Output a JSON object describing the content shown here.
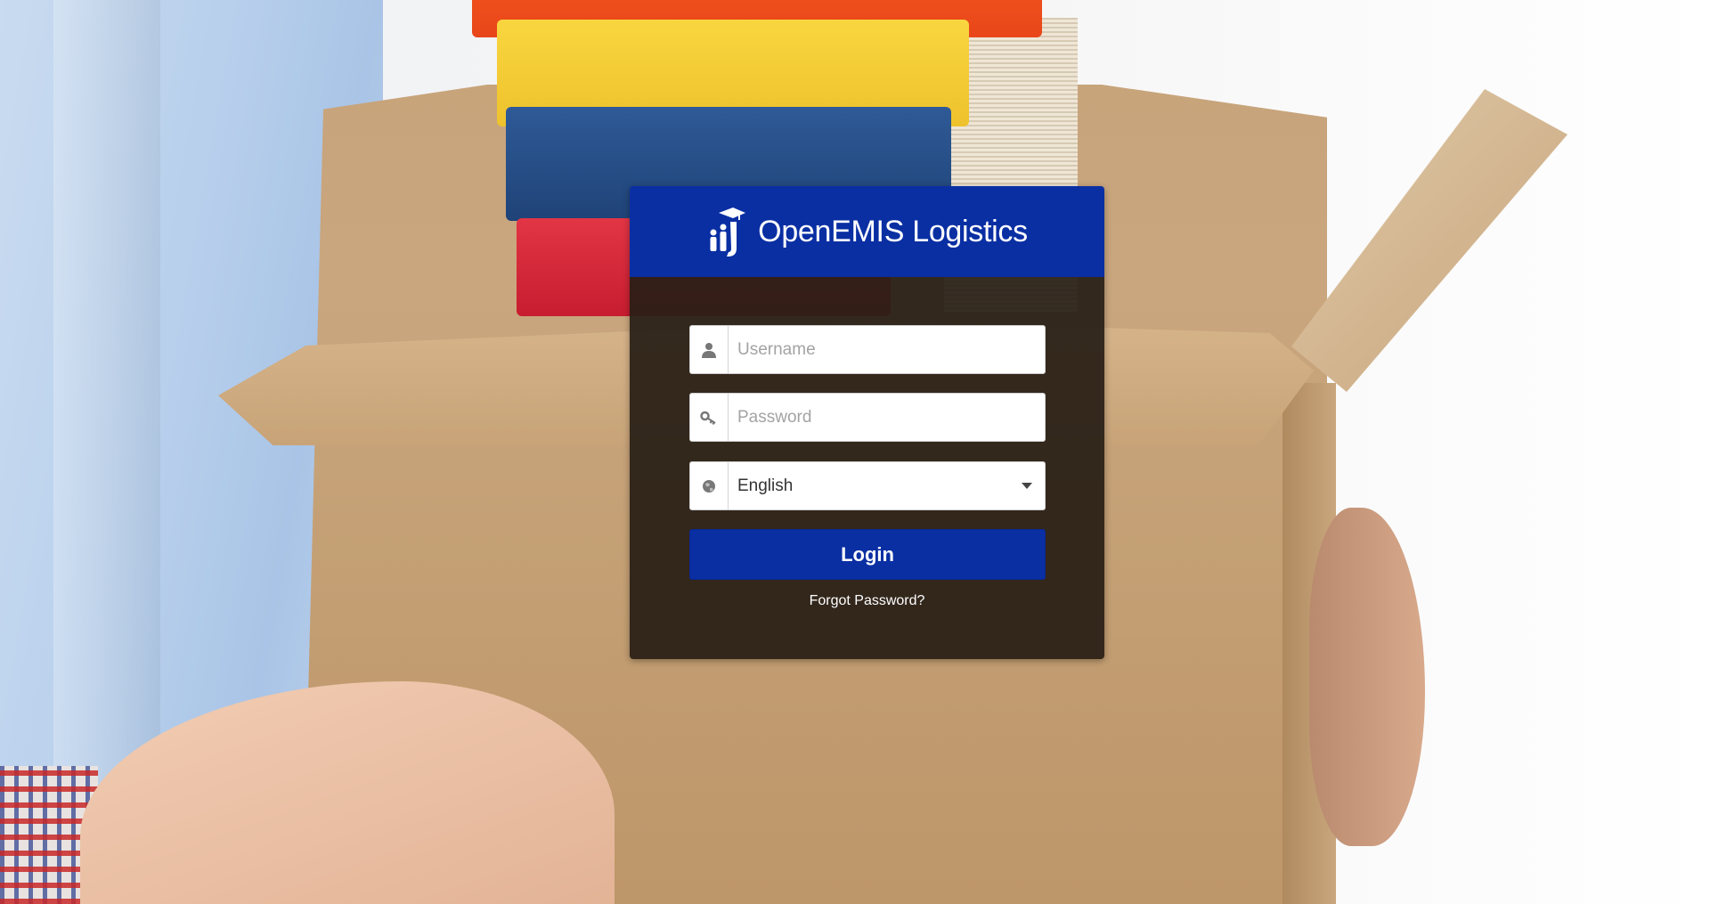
{
  "app": {
    "title": "OpenEMIS Logistics",
    "brand_color": "#0a2fa3",
    "logo_icon": "openemis-logo-icon"
  },
  "login_form": {
    "username": {
      "placeholder": "Username",
      "value": "",
      "icon": "user-icon"
    },
    "password": {
      "placeholder": "Password",
      "value": "",
      "icon": "key-icon"
    },
    "language": {
      "selected": "English",
      "icon": "globe-icon",
      "options": [
        "English"
      ]
    },
    "login_label": "Login",
    "forgot_password_label": "Forgot Password?"
  }
}
